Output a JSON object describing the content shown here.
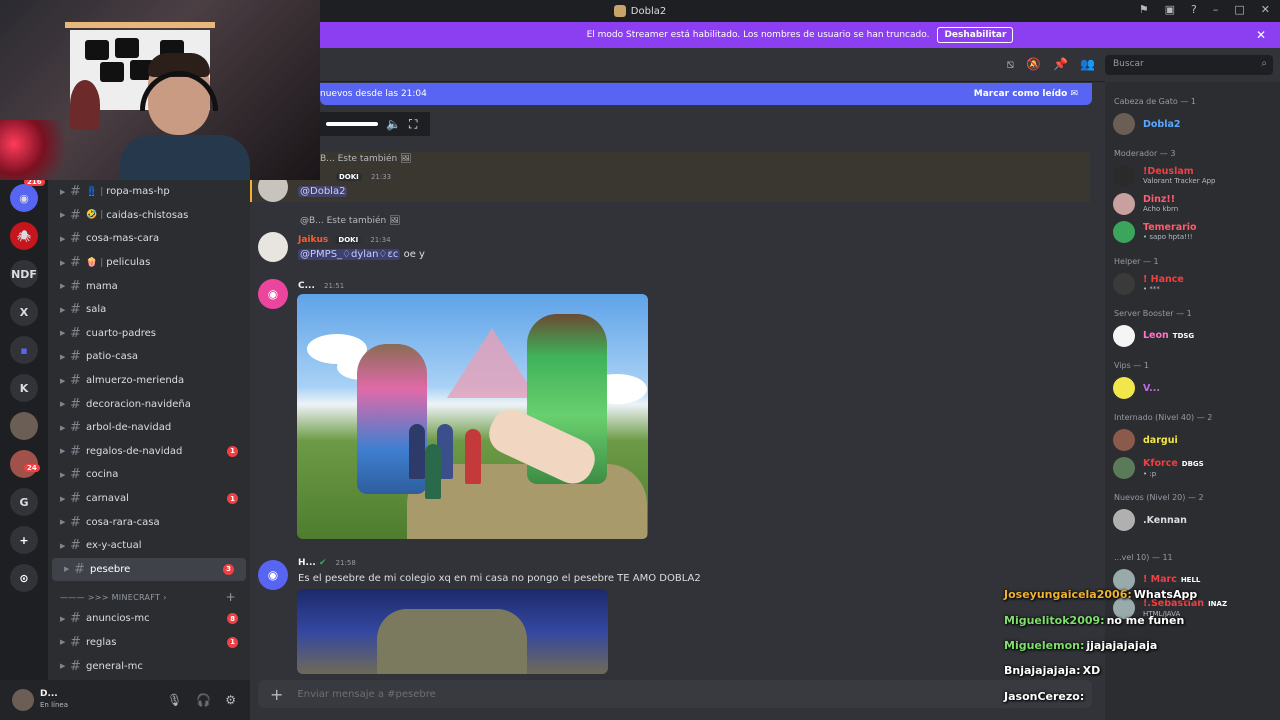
{
  "window": {
    "title": "Dobla2"
  },
  "banner": {
    "text": "El modo Streamer está habilitado. Los nombres de usuario se han truncado.",
    "button": "Deshabilitar"
  },
  "rail": {
    "badge_top": "216",
    "items": [
      "NDF",
      "X",
      "K",
      "G"
    ],
    "badge_24": "24"
  },
  "channels": [
    {
      "label": "ropa-mas-hp",
      "emoji": "👖"
    },
    {
      "label": "caidas-chistosas",
      "emoji": "🤣"
    },
    {
      "label": "cosa-mas-cara",
      "emoji": ""
    },
    {
      "label": "peliculas",
      "emoji": "🍿"
    },
    {
      "label": "mama",
      "emoji": ""
    },
    {
      "label": "sala",
      "emoji": ""
    },
    {
      "label": "cuarto-padres",
      "emoji": ""
    },
    {
      "label": "patio-casa",
      "emoji": ""
    },
    {
      "label": "almuerzo-merienda",
      "emoji": ""
    },
    {
      "label": "decoracion-navideña",
      "emoji": ""
    },
    {
      "label": "arbol-de-navidad",
      "emoji": ""
    },
    {
      "label": "regalos-de-navidad",
      "emoji": "",
      "unread": "1"
    },
    {
      "label": "cocina",
      "emoji": ""
    },
    {
      "label": "carnaval",
      "emoji": "",
      "unread": "1"
    },
    {
      "label": "cosa-rara-casa",
      "emoji": ""
    },
    {
      "label": "ex-y-actual",
      "emoji": ""
    },
    {
      "label": "pesebre",
      "emoji": "",
      "unread": "3",
      "active": true
    }
  ],
  "category_minecraft": "——— >>> MINECRAFT",
  "channels_mc": [
    {
      "label": "anuncios-mc",
      "unread": "8"
    },
    {
      "label": "reglas",
      "unread": "1"
    },
    {
      "label": "general-mc"
    }
  ],
  "user": {
    "name": "D...",
    "status": "En línea"
  },
  "search": {
    "placeholder": "Buscar"
  },
  "newbar": {
    "text": "nuevos desde las 21:04",
    "mark": "Marcar como leído"
  },
  "messages": {
    "m1": {
      "reply": "B... Este también",
      "role": "DOKI",
      "time": "21:33",
      "text": "@Dobla2"
    },
    "m2": {
      "reply": "@B... Este también",
      "author": "Jaikus",
      "role": "DOKI",
      "time": "21:34",
      "mention": "@PMPS_♢dylan♢ɛc",
      "text": "oe y"
    },
    "m3": {
      "author": "C...",
      "time": "21:51"
    },
    "m4": {
      "author": "H...",
      "time": "21:58",
      "text": "Es el pesebre de mi colegio xq en mi casa no pongo el pesebre TE AMO DOBLA2"
    }
  },
  "composer": {
    "placeholder": "Enviar mensaje a #pesebre"
  },
  "members": {
    "groups": [
      {
        "title": "Cabeza de Gato — 1",
        "items": [
          {
            "name": "Dobla2",
            "color": "#5aa9ff",
            "sub": ""
          }
        ]
      },
      {
        "title": "Moderador — 3",
        "items": [
          {
            "name": "!Deuslam",
            "color": "#f23f43",
            "sub": "Valorant Tracker App"
          },
          {
            "name": "Dinz!!",
            "color": "#ff5c6e",
            "sub": "Acho kbrn"
          },
          {
            "name": "Temerario",
            "color": "#ff5c6e",
            "sub": "• sapo hpta!!!"
          }
        ]
      },
      {
        "title": "Helper — 1",
        "items": [
          {
            "name": "! Hance",
            "color": "#f23f43",
            "sub": "• ***"
          }
        ]
      },
      {
        "title": "Server Booster — 1",
        "items": [
          {
            "name": "Leon",
            "color": "#ff73c8",
            "sub": "",
            "tag": "TDSG"
          }
        ]
      },
      {
        "title": "Vips — 1",
        "items": [
          {
            "name": "V...",
            "color": "#c46be0",
            "sub": ""
          }
        ]
      },
      {
        "title": "Internado (Nivel 40) — 2",
        "items": [
          {
            "name": "dargui",
            "color": "#f1e64b",
            "sub": ""
          },
          {
            "name": "Kforce",
            "color": "#f23f43",
            "sub": "• :p",
            "tag": "DBGS"
          }
        ]
      },
      {
        "title": "Nuevos (Nivel 20) — 2",
        "items": [
          {
            "name": ".Kennan",
            "color": "#dbdee1",
            "sub": ""
          }
        ]
      }
    ],
    "lower": [
      {
        "name": "! Marc",
        "color": "#f23f43",
        "sub": "",
        "tag": "HELL"
      },
      {
        "name": "!.Sebastian",
        "color": "#f23f43",
        "sub": "HTML/JAVA",
        "tag": "INAZ"
      }
    ],
    "lower_group": "...vel 10) — 11"
  },
  "stream_chat": [
    {
      "user": "Joseyungaicela2006:",
      "user_color": "#f0b232",
      "msg": "WhatsApp"
    },
    {
      "user": "Miguelitok2009:",
      "user_color": "#7ee06a",
      "msg": "no me funen"
    },
    {
      "user": "Miguelemon:",
      "user_color": "#7ee06a",
      "msg": "jjajajajajaja"
    },
    {
      "user": "Bnjajajajaja:",
      "user_color": "#ffffff",
      "msg": "XD"
    },
    {
      "user": "JasonCerezo:",
      "user_color": "#ffffff",
      "msg": ""
    }
  ]
}
